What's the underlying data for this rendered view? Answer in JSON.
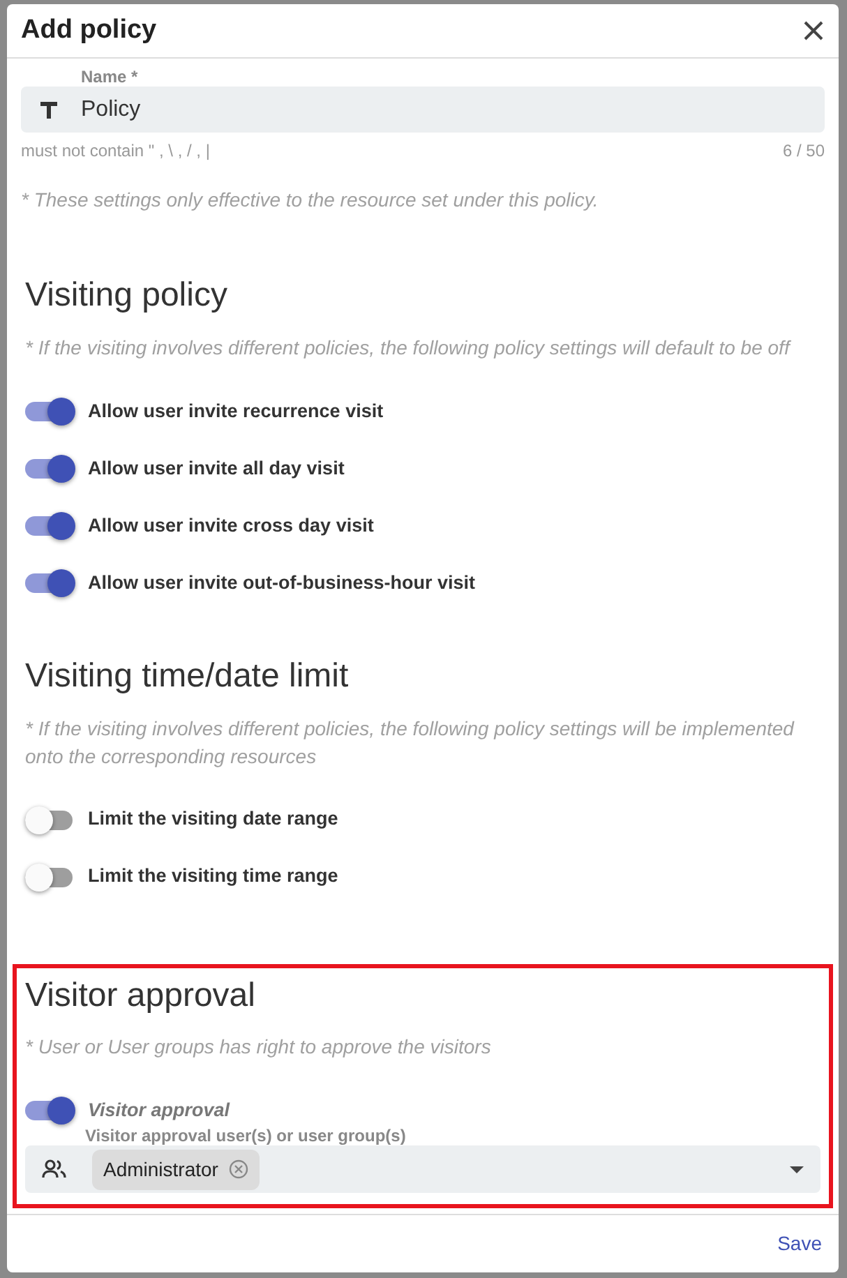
{
  "dialog": {
    "title": "Add policy"
  },
  "name_field": {
    "label": "Name *",
    "value": "Policy",
    "hint": "must not contain \" , \\ , / , |",
    "counter": "6 / 50"
  },
  "note": "* These settings only effective to the resource set under this policy.",
  "sections": [
    {
      "title": "Visiting policy",
      "note": "* If the visiting involves different policies, the following policy settings will default to be off",
      "highlighted": false,
      "toggles": [
        {
          "label": "Allow user invite recurrence visit",
          "on": true
        },
        {
          "label": "Allow user invite all day visit",
          "on": true
        },
        {
          "label": "Allow user invite cross day visit",
          "on": true
        },
        {
          "label": "Allow user invite out-of-business-hour visit",
          "on": true
        }
      ]
    },
    {
      "title": "Visiting time/date limit",
      "note": "* If the visiting involves different policies, the following policy settings will be implemented onto the corresponding resources",
      "highlighted": false,
      "toggles": [
        {
          "label": "Limit the visiting date range",
          "on": false
        },
        {
          "label": "Limit the visiting time range",
          "on": false
        }
      ]
    },
    {
      "title": "Visitor approval",
      "note": "* User or User groups has right to approve the visitors",
      "highlighted": true,
      "toggles": [
        {
          "label": "Visitor approval",
          "on": true,
          "italic": true
        }
      ],
      "select": {
        "label": "Visitor approval user(s) or user group(s)",
        "chips": [
          "Administrator"
        ]
      }
    }
  ],
  "footer": {
    "buttons": [
      "Save"
    ]
  }
}
